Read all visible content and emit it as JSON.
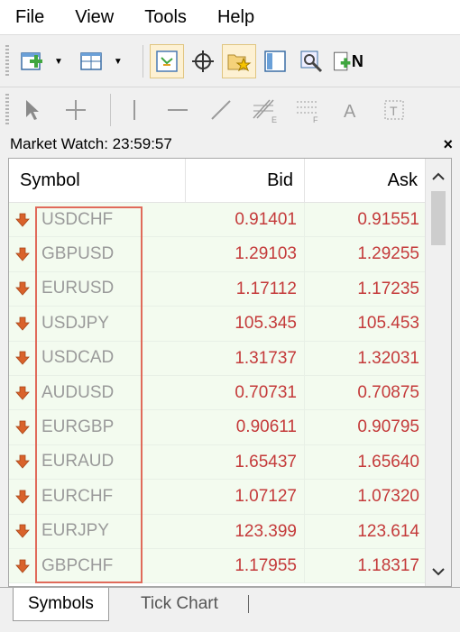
{
  "menu": [
    "File",
    "View",
    "Tools",
    "Help"
  ],
  "toolbar": {
    "row1": [
      "new-chart-icon",
      "profiles-icon",
      "chart-window-icon",
      "crosshair-icon",
      "favorites-icon",
      "navigator-icon",
      "strategy-tester-icon",
      "new-order-icon"
    ],
    "row2": [
      "cursor-icon",
      "crosshair-line-icon",
      "vertical-line-icon",
      "horizontal-line-icon",
      "trendline-icon",
      "fibonacci-icon",
      "channel-icon",
      "text-icon",
      "text-label-icon"
    ],
    "row1_partial_letter": "N"
  },
  "market_watch": {
    "title": "Market Watch: 23:59:57",
    "close": "×",
    "columns": {
      "symbol": "Symbol",
      "bid": "Bid",
      "ask": "Ask"
    },
    "rows": [
      {
        "symbol": "USDCHF",
        "bid": "0.91401",
        "ask": "0.91551"
      },
      {
        "symbol": "GBPUSD",
        "bid": "1.29103",
        "ask": "1.29255"
      },
      {
        "symbol": "EURUSD",
        "bid": "1.17112",
        "ask": "1.17235"
      },
      {
        "symbol": "USDJPY",
        "bid": "105.345",
        "ask": "105.453"
      },
      {
        "symbol": "USDCAD",
        "bid": "1.31737",
        "ask": "1.32031"
      },
      {
        "symbol": "AUDUSD",
        "bid": "0.70731",
        "ask": "0.70875"
      },
      {
        "symbol": "EURGBP",
        "bid": "0.90611",
        "ask": "0.90795"
      },
      {
        "symbol": "EURAUD",
        "bid": "1.65437",
        "ask": "1.65640"
      },
      {
        "symbol": "EURCHF",
        "bid": "1.07127",
        "ask": "1.07320"
      },
      {
        "symbol": "EURJPY",
        "bid": "123.399",
        "ask": "123.614"
      },
      {
        "symbol": "GBPCHF",
        "bid": "1.17955",
        "ask": "1.18317"
      }
    ]
  },
  "tabs": [
    {
      "label": "Symbols",
      "active": true
    },
    {
      "label": "Tick Chart",
      "active": false
    }
  ],
  "colors": {
    "price": "#c43a3a",
    "row_bg": "#f3fbef",
    "highlight": "#e06a5a",
    "down_arrow": "#d9622b"
  }
}
